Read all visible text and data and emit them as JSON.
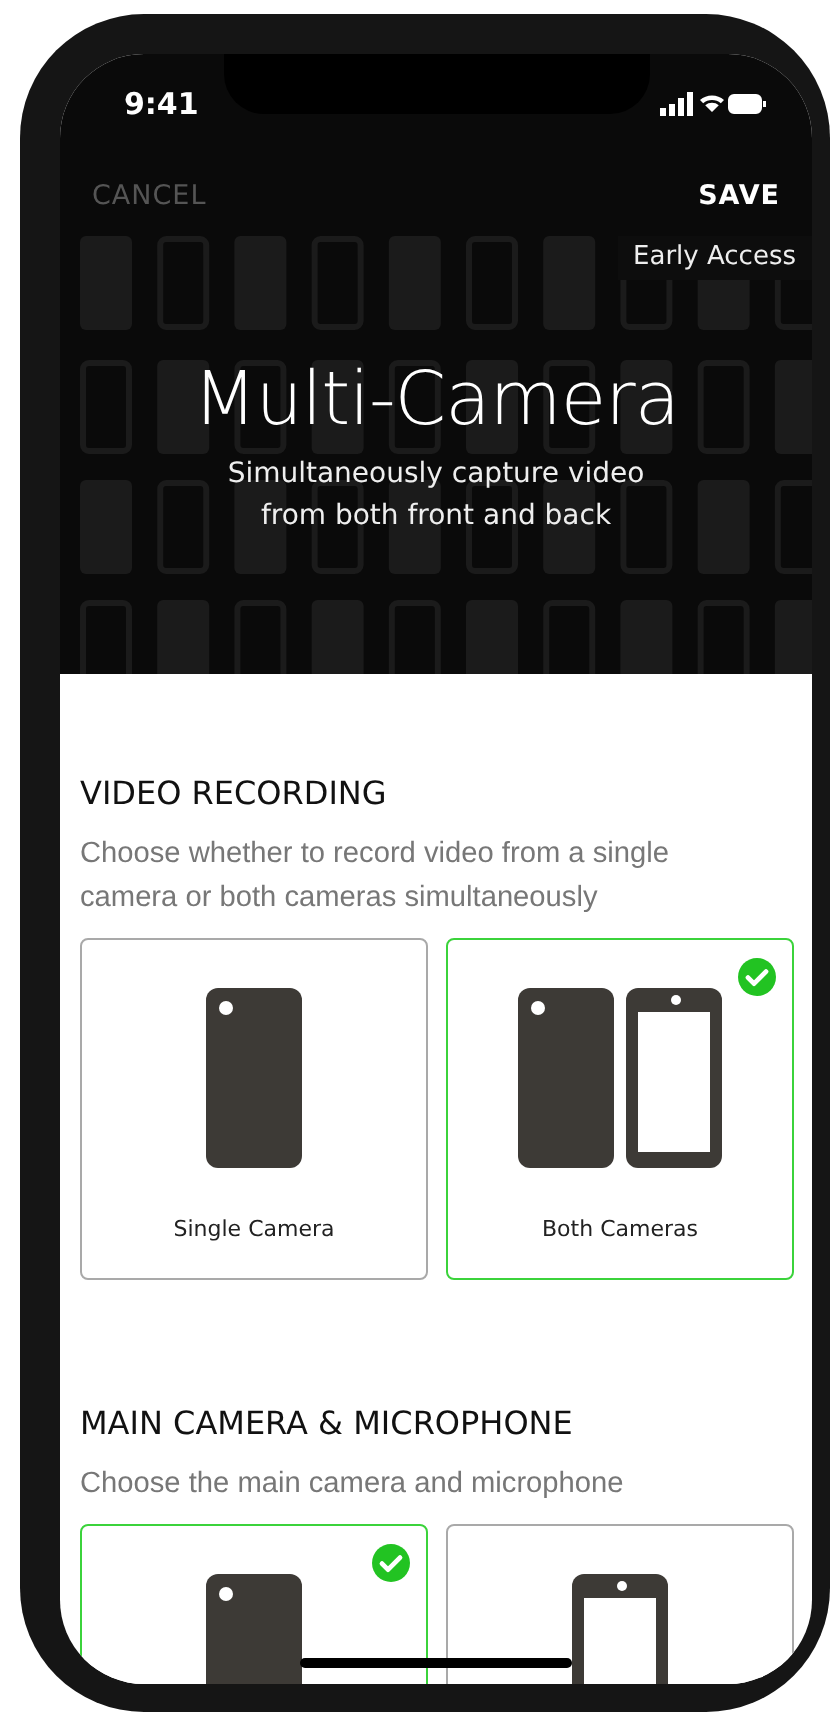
{
  "status_bar": {
    "time": "9:41"
  },
  "nav": {
    "cancel": {
      "label": "CANCEL",
      "disabled": true
    },
    "save": {
      "label": "SAVE",
      "disabled": false
    }
  },
  "hero": {
    "badge": "Early Access",
    "title": "Multi-Camera",
    "subtitle": "Simultaneously capture video from both front and back"
  },
  "sections": [
    {
      "heading": "VIDEO RECORDING",
      "description": "Choose whether to record video from a single camera or both cameras simultaneously",
      "options": [
        {
          "label": "Single Camera",
          "kind": "back",
          "selected": false
        },
        {
          "label": "Both Cameras",
          "kind": "both",
          "selected": true
        }
      ]
    },
    {
      "heading": "MAIN CAMERA & MICROPHONE",
      "description": "Choose the main camera and microphone",
      "options": [
        {
          "kind": "back",
          "selected": true
        },
        {
          "kind": "front",
          "selected": false
        }
      ]
    }
  ]
}
